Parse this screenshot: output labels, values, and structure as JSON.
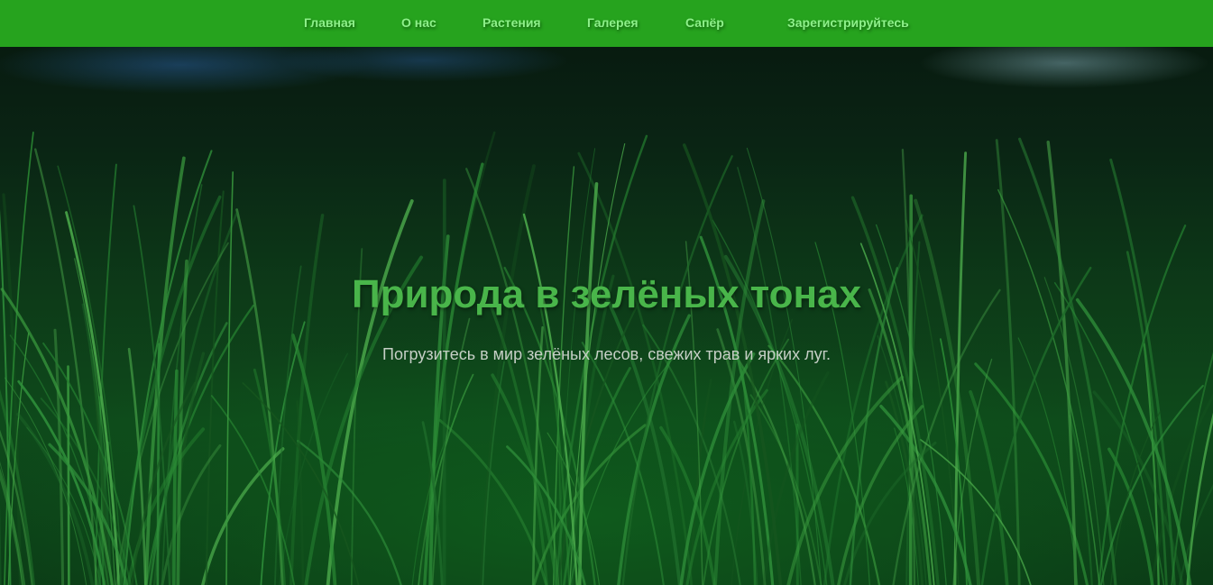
{
  "nav": {
    "items": [
      {
        "label": "Главная"
      },
      {
        "label": "О нас"
      },
      {
        "label": "Растения"
      },
      {
        "label": "Галерея"
      },
      {
        "label": "Сапёр"
      },
      {
        "label": "Зарегистрируйтесь"
      }
    ]
  },
  "hero": {
    "title": "Природа в зелёных тонах",
    "subtitle": "Погрузитесь в мир зелёных лесов, свежих трав и ярких луг."
  },
  "colors": {
    "nav_background": "#26a31e",
    "nav_link": "#8ef08a",
    "title": "#49b54a",
    "subtitle": "#c6cfc6"
  }
}
